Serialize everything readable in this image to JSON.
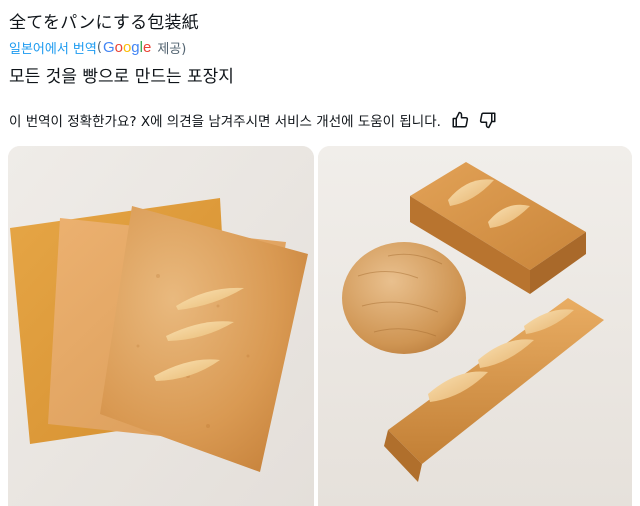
{
  "post": {
    "original_text": "全てをパンにする包装紙",
    "translated_from": "일본어에서 번역",
    "paren_open": "(",
    "google": "Google",
    "provided": "제공)",
    "translated_text": "모든 것을 빵으로 만드는 포장지"
  },
  "feedback": {
    "question": "이 번역이 정확한가요? X에 의견을 남겨주시면 서비스 개선에 도움이 됩니다.",
    "thumbs_up_icon": "thumbs-up-icon",
    "thumbs_down_icon": "thumbs-down-icon"
  },
  "colors": {
    "link": "#1d9bf0",
    "text": "#0f1419",
    "muted": "#536471"
  }
}
